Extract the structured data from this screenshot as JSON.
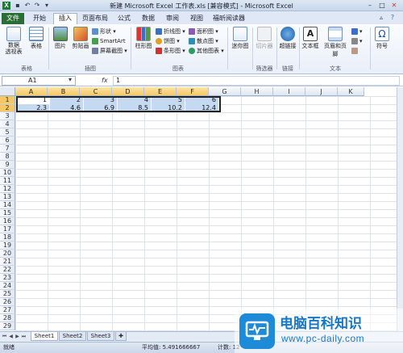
{
  "window": {
    "title": "新建 Microsoft Excel 工作表.xls  [兼容模式] - Microsoft Excel",
    "app_icon": "X"
  },
  "ribbon_tabs": [
    {
      "label": "文件"
    },
    {
      "label": "开始"
    },
    {
      "label": "插入"
    },
    {
      "label": "页面布局"
    },
    {
      "label": "公式"
    },
    {
      "label": "数据"
    },
    {
      "label": "审阅"
    },
    {
      "label": "视图"
    },
    {
      "label": "福昕阅读器"
    }
  ],
  "active_tab": "插入",
  "ribbon": {
    "pivot_label": "数据\n透视表",
    "table_label": "表格",
    "picture_label": "图片",
    "clipart_label": "剪贴画",
    "shapes_label": "形状",
    "smartart_label": "SmartArt",
    "screenshot_label": "屏幕截图",
    "column_chart_label": "柱形图",
    "line_label": "折线图",
    "pie_label": "饼图",
    "bar_label": "条形图",
    "area_label": "面积图",
    "scatter_label": "散点图",
    "other_label": "其他图表",
    "sparkline_label": "迷你图",
    "slicer_label": "切片器",
    "hyperlink_label": "超链接",
    "textbox_label": "文本框",
    "headerfooter_label": "页眉和页脚",
    "symbol_label": "符号",
    "groups": {
      "tables": "表格",
      "illustrations": "插图",
      "charts": "图表",
      "filter": "筛选器",
      "links": "链接",
      "text": "文本"
    }
  },
  "formula_bar": {
    "name_box": "A1",
    "fx": "fx",
    "value": "1"
  },
  "columns": [
    "A",
    "B",
    "C",
    "D",
    "E",
    "F",
    "G",
    "H",
    "I",
    "J",
    "K"
  ],
  "rows": [
    "1",
    "2",
    "3",
    "4",
    "5",
    "6",
    "7",
    "8",
    "9",
    "10",
    "11",
    "12",
    "13",
    "14",
    "15",
    "16",
    "17",
    "18",
    "19",
    "20",
    "21",
    "22",
    "23",
    "24",
    "25",
    "26",
    "27",
    "28",
    "29"
  ],
  "cells": {
    "row1": [
      "1",
      "2",
      "3",
      "4",
      "5",
      "6"
    ],
    "row2": [
      "2.3",
      "4.6",
      "6.9",
      "8.5",
      "10.2",
      "12.4"
    ]
  },
  "sheets": [
    {
      "label": "Sheet1"
    },
    {
      "label": "Sheet2"
    },
    {
      "label": "Sheet3"
    }
  ],
  "status": {
    "ready": "就绪",
    "average": "平均值: 5.491666667",
    "count": "计数: 12"
  },
  "watermark": {
    "cn": "电脑百科知识",
    "url": "www.pc-daily.com"
  }
}
